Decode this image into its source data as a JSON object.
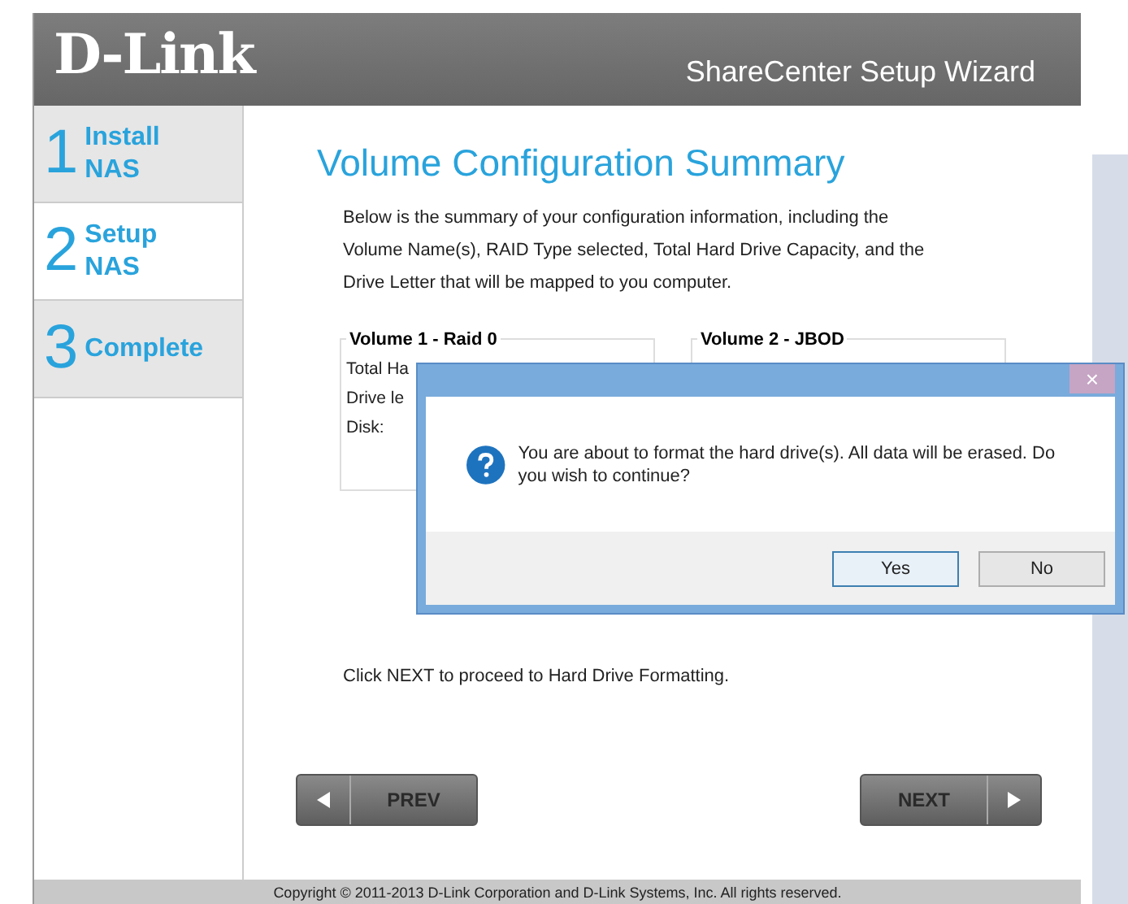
{
  "header": {
    "logo": "D-Link",
    "title": "ShareCenter Setup Wizard"
  },
  "steps": [
    {
      "number": "1",
      "label": "Install NAS",
      "selected": false
    },
    {
      "number": "2",
      "label": "Setup NAS",
      "selected": true
    },
    {
      "number": "3",
      "label": "Complete",
      "selected": false
    }
  ],
  "content": {
    "heading": "Volume Configuration Summary",
    "intro": "Below is the summary of your configuration information, including the Volume Name(s), RAID Type selected, Total Hard Drive Capacity, and the Drive Letter that will be mapped to you computer.",
    "volumes": [
      {
        "title": "Volume 1 - Raid 0",
        "lines": [
          "Total Ha",
          "Drive le",
          "Disk:"
        ]
      },
      {
        "title": "Volume 2 - JBOD"
      }
    ],
    "instruction": "Click NEXT to proceed to Hard Drive Formatting."
  },
  "nav": {
    "prev": "PREV",
    "next": "NEXT",
    "prev_disabled": true,
    "next_disabled": true
  },
  "footer": "Copyright © 2011-2013 D-Link Corporation and D-Link Systems, Inc. All rights reserved.",
  "dialog": {
    "close": "×",
    "message": "You are about to format the hard drive(s). All data will be erased. Do you wish to continue?",
    "buttons": [
      {
        "label": "Yes",
        "selected": true
      },
      {
        "label": "No",
        "selected": false
      }
    ]
  }
}
